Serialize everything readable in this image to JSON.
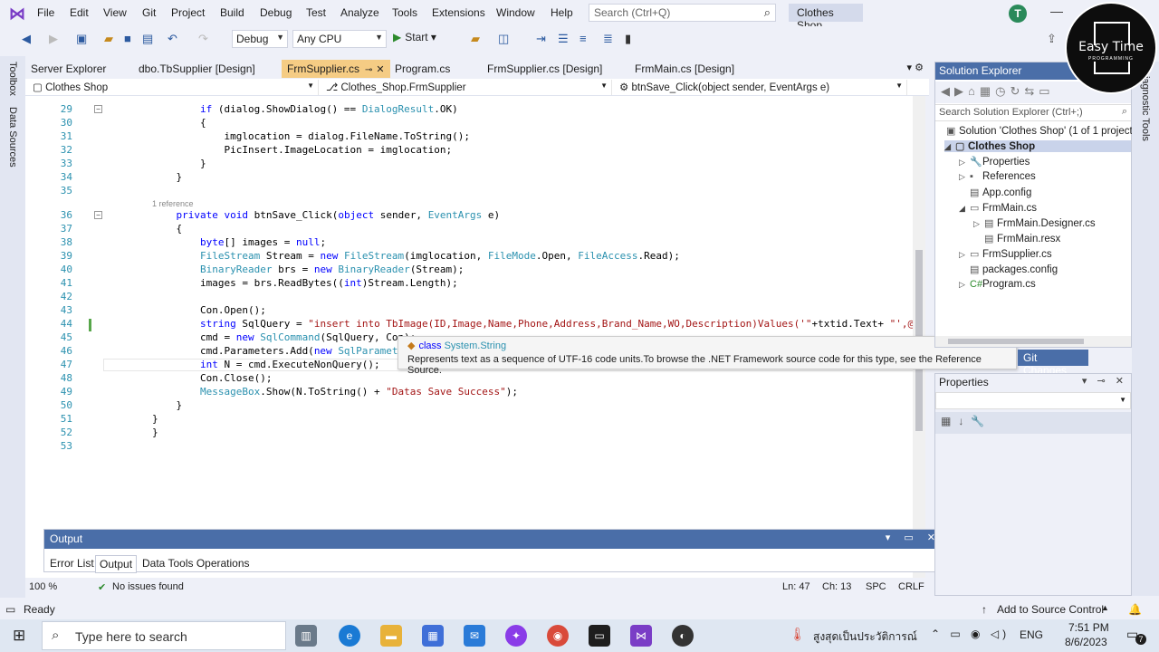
{
  "menu": {
    "items": [
      "File",
      "Edit",
      "View",
      "Git",
      "Project",
      "Build",
      "Debug",
      "Test",
      "Analyze",
      "Tools",
      "Extensions",
      "Window",
      "Help"
    ],
    "search_placeholder": "Search (Ctrl+Q)",
    "solution_name": "Clothes Shop",
    "avatar_initial": "T"
  },
  "toolbar": {
    "configuration": "Debug",
    "platform": "Any CPU",
    "start_label": "Start"
  },
  "left_strip": [
    "Toolbox",
    "Data Sources"
  ],
  "right_strip": "Diagnostic Tools",
  "doc_tabs": [
    {
      "label": "Server Explorer"
    },
    {
      "label": "dbo.TbSupplier [Design]"
    },
    {
      "label": "FrmSupplier.cs"
    },
    {
      "label": "Program.cs"
    },
    {
      "label": "FrmSupplier.cs [Design]"
    },
    {
      "label": "FrmMain.cs [Design]"
    }
  ],
  "navbar": {
    "project": "Clothes Shop",
    "class": "Clothes_Shop.FrmSupplier",
    "member": "btnSave_Click(object sender, EventArgs e)"
  },
  "editor": {
    "reference_hint": "1 reference",
    "lines": [
      {
        "n": "29",
        "code": "        if (dialog.ShowDialog() == DialogResult.OK)"
      },
      {
        "n": "30",
        "code": "        {"
      },
      {
        "n": "31",
        "code": "            imglocation = dialog.FileName.ToString();"
      },
      {
        "n": "32",
        "code": "            PicInsert.ImageLocation = imglocation;"
      },
      {
        "n": "33",
        "code": "        }"
      },
      {
        "n": "34",
        "code": "    }"
      },
      {
        "n": "35",
        "code": ""
      },
      {
        "n": "36",
        "code": "    private void btnSave_Click(object sender, EventArgs e)"
      },
      {
        "n": "37",
        "code": "    {"
      },
      {
        "n": "38",
        "code": "        byte[] images = null;"
      },
      {
        "n": "39",
        "code": "        FileStream Stream = new FileStream(imglocation, FileMode.Open, FileAccess.Read);"
      },
      {
        "n": "40",
        "code": "        BinaryReader brs = new BinaryReader(Stream);"
      },
      {
        "n": "41",
        "code": "        images = brs.ReadBytes((int)Stream.Length);"
      },
      {
        "n": "42",
        "code": ""
      },
      {
        "n": "43",
        "code": "        Con.Open();"
      },
      {
        "n": "44",
        "code": "        string SqlQuery = \"insert into TbImage(ID,Image,Name,Phone,Address,Brand_Name,WO,Description)Values('\"+txtid.Text+ \"',@imag"
      },
      {
        "n": "45",
        "code": "        cmd = new SqlCommand(SqlQuery, Con);"
      },
      {
        "n": "46",
        "code": "        cmd.Parameters.Add(new SqlParameter(\""
      },
      {
        "n": "47",
        "code": "        int N = cmd.ExecuteNonQuery();"
      },
      {
        "n": "48",
        "code": "        Con.Close();"
      },
      {
        "n": "49",
        "code": "        MessageBox.Show(N.ToString() + \"Datas Save Success\");"
      },
      {
        "n": "50",
        "code": "    }"
      },
      {
        "n": "51",
        "code": "}"
      },
      {
        "n": "52",
        "code": "}"
      },
      {
        "n": "53",
        "code": ""
      }
    ]
  },
  "tooltip": {
    "kind": "class",
    "name": "System.String",
    "description": "Represents text as a sequence of UTF-16 code units.To browse the .NET Framework source code for this type, see the Reference Source."
  },
  "output_panel": {
    "title": "Output",
    "tabs": [
      "Error List",
      "Output",
      "Data Tools Operations"
    ]
  },
  "editor_status": {
    "zoom": "100 %",
    "issues": "No issues found",
    "line": "Ln: 47",
    "col": "Ch: 13",
    "spc": "SPC",
    "crlf": "CRLF"
  },
  "solution_explorer": {
    "title": "Solution Explorer",
    "search_placeholder": "Search Solution Explorer (Ctrl+;)",
    "items": [
      {
        "label": "Solution 'Clothes Shop' (1 of 1 project"
      },
      {
        "label": "Clothes Shop"
      },
      {
        "label": "Properties"
      },
      {
        "label": "References"
      },
      {
        "label": "App.config"
      },
      {
        "label": "FrmMain.cs"
      },
      {
        "label": "FrmMain.Designer.cs"
      },
      {
        "label": "FrmMain.resx"
      },
      {
        "label": "FrmSupplier.cs"
      },
      {
        "label": "packages.config"
      },
      {
        "label": "Program.cs"
      }
    ]
  },
  "git_changes": "Git Changes",
  "properties_panel": {
    "title": "Properties"
  },
  "status_bar": {
    "ready": "Ready",
    "source_control": "Add to Source Control"
  },
  "taskbar": {
    "search_placeholder": "Type here to search",
    "weather": "สูงสุดเป็นประวัติการณ์",
    "lang": "ENG",
    "time": "7:51 PM",
    "date": "8/6/2023",
    "notification_count": "7"
  },
  "watermark": {
    "name": "Easy Time",
    "sub": "PROGRAMMING"
  }
}
